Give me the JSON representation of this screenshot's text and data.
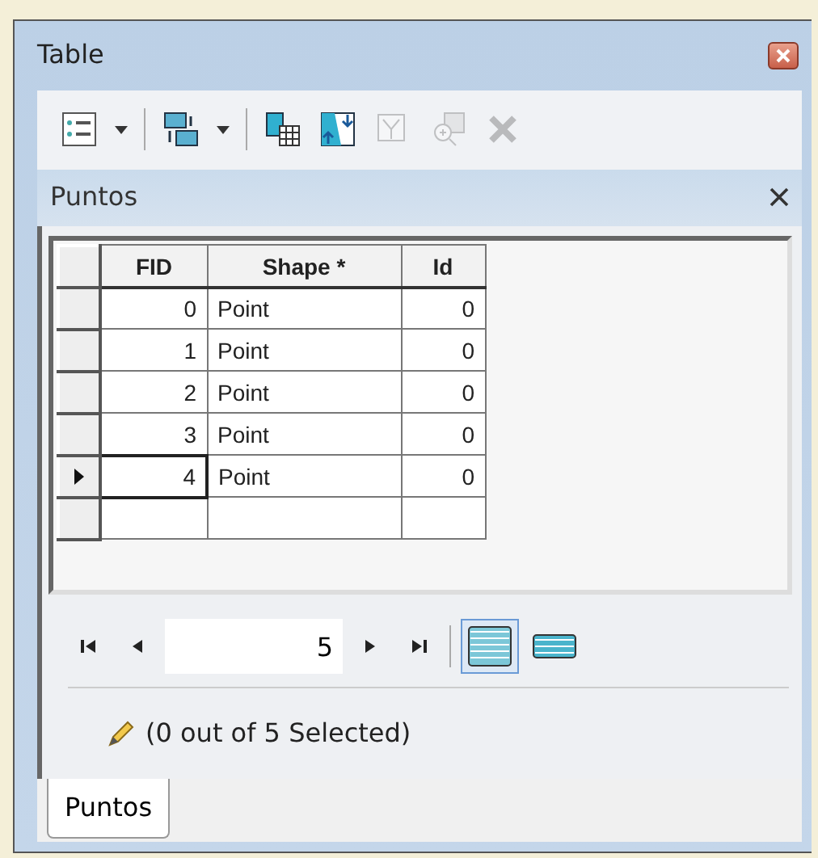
{
  "window": {
    "title": "Table"
  },
  "toolbar": [
    {
      "kind": "options",
      "disabled": false,
      "dropdown": true
    },
    {
      "kind": "related",
      "disabled": false,
      "dropdown": true
    },
    {
      "kind": "select-attr",
      "disabled": false,
      "dropdown": false
    },
    {
      "kind": "switch",
      "disabled": false,
      "dropdown": false
    },
    {
      "kind": "clear",
      "disabled": true,
      "dropdown": false
    },
    {
      "kind": "zoom",
      "disabled": true,
      "dropdown": false
    },
    {
      "kind": "delete",
      "disabled": true,
      "dropdown": false
    }
  ],
  "panel": {
    "title": "Puntos"
  },
  "table": {
    "columns": [
      "FID",
      "Shape *",
      "Id"
    ],
    "rows": [
      {
        "cells": [
          "0",
          "Point",
          "0"
        ],
        "current": false
      },
      {
        "cells": [
          "1",
          "Point",
          "0"
        ],
        "current": false
      },
      {
        "cells": [
          "2",
          "Point",
          "0"
        ],
        "current": false
      },
      {
        "cells": [
          "3",
          "Point",
          "0"
        ],
        "current": false
      },
      {
        "cells": [
          "4",
          "Point",
          "0"
        ],
        "current": true
      }
    ]
  },
  "navigator": {
    "record": "5",
    "views": [
      {
        "kind": "all",
        "selected": true
      },
      {
        "kind": "selected",
        "selected": false
      }
    ]
  },
  "status": "(0 out of 5 Selected)",
  "tabs": [
    {
      "label": "Puntos",
      "selected": true
    }
  ]
}
